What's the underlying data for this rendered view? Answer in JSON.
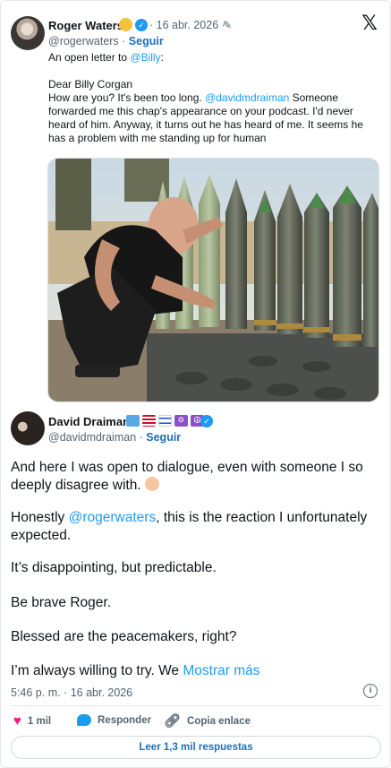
{
  "quoted_tweet": {
    "author_name": "Roger Waters",
    "date": "· 16 abr. 2026 ·",
    "handle": "@rogerwaters",
    "follow_label": "Seguir",
    "intro_prefix": "An open letter to ",
    "intro_mention": "@Billy",
    "intro_suffix": ":",
    "line_greeting": "Dear Billy Corgan",
    "line_1_prefix": "How are you? It's been too long. ",
    "line_1_mention": "@davidmdraiman",
    "line_1_suffix": "  Someone",
    "line_2": "forwarded me this chap's appearance on your podcast. I'd never",
    "line_3": "heard of him. Anyway, it turns out he has heard of me. It seems he",
    "line_4": "has a problem with me standing up for human"
  },
  "main_tweet": {
    "author_name": "David Draiman",
    "handle": "@davidmdraiman",
    "follow_label": "Seguir",
    "para_1_line_1": "And here I was open to dialogue, even with someone I so",
    "para_1_line_2": "deeply disagree with.",
    "para_2_prefix": "Honestly ",
    "para_2_mention": "@rogerwaters",
    "para_2_suffix": ", this is the reaction I unfortunately",
    "para_2_line_2": "expected.",
    "para_3": "It’s disappointing, but predictable.",
    "para_4": "Be brave Roger.",
    "para_5": "Blessed are the peacemakers, right?",
    "para_6_prefix": "I’m always willing to try. We ",
    "show_more": "Mostrar más",
    "timestamp": "5:46 p. m. · 16 abr. 2026"
  },
  "actions": {
    "likes": "1 mil",
    "reply": "Responder",
    "copy_link": "Copia enlace",
    "read_replies": "Leer 1,3 mil respuestas"
  },
  "icons": {
    "platform": "x-logo-icon",
    "verified": "verified-badge-icon",
    "edited": "pencil-icon",
    "info": "info-icon",
    "like": "heart-icon",
    "reply": "speech-bubble-icon",
    "copy_link": "link-icon"
  },
  "colors": {
    "accent": "#1d9bf0",
    "link_dark": "#1d70b8",
    "like": "#f91880",
    "muted": "#536471"
  }
}
